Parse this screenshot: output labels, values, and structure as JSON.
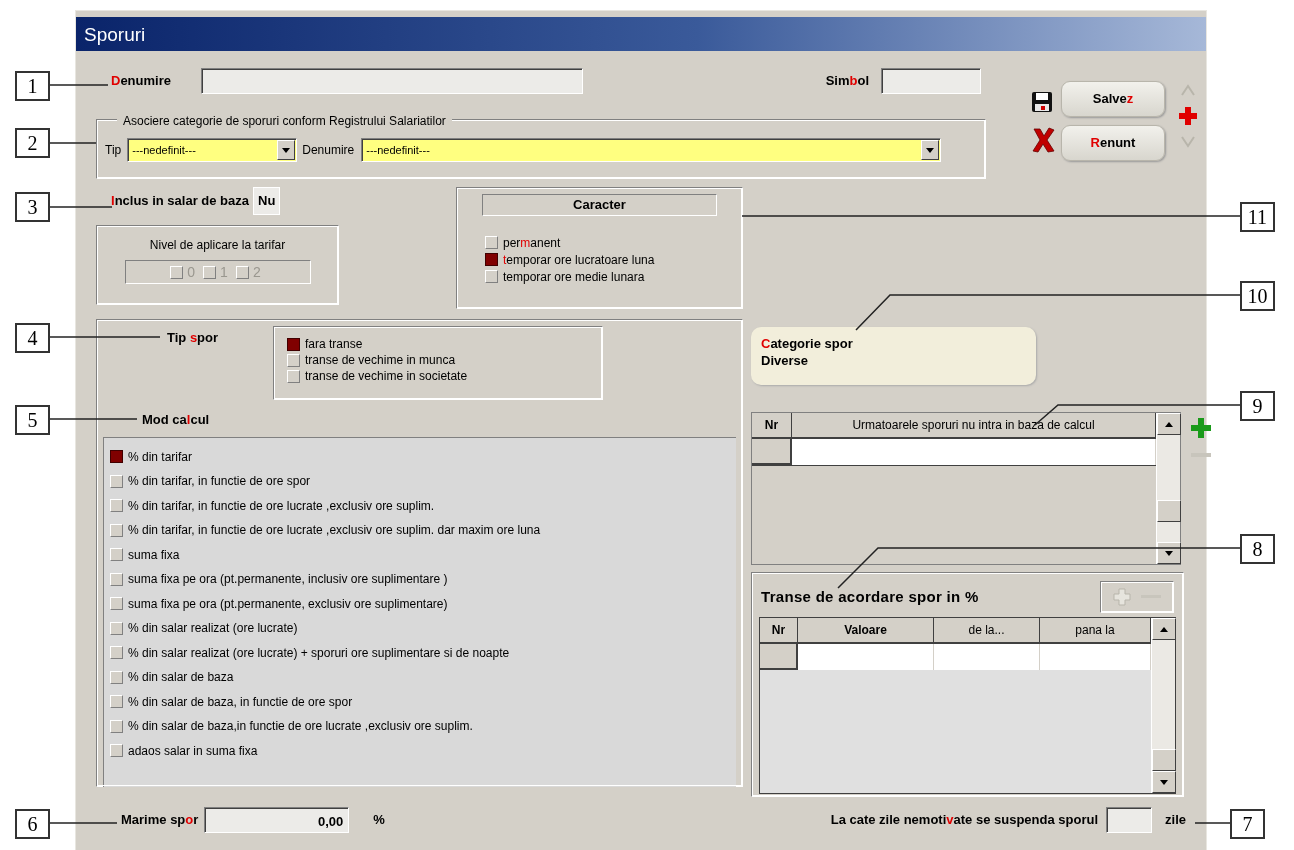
{
  "window": {
    "title": "Sporuri"
  },
  "denumire": {
    "label": [
      {
        "text": "D",
        "accent": true
      },
      {
        "text": "enumire",
        "accent": false
      }
    ]
  },
  "simbol": {
    "label": [
      {
        "text": "Sim",
        "accent": false
      },
      {
        "text": "b",
        "accent": true
      },
      {
        "text": "ol",
        "accent": false
      }
    ]
  },
  "asociere": {
    "legend": "Asociere categorie de sporuri conform Registrului Salariatilor",
    "tip": {
      "label": "Tip",
      "value": "---nedefinit---"
    },
    "denumire": {
      "label": "Denumire",
      "value": "---nedefinit---"
    }
  },
  "actions": [
    {
      "kind": "save",
      "label": [
        {
          "text": "Salve",
          "accent": false
        },
        {
          "text": "z",
          "accent": true
        }
      ]
    },
    {
      "kind": "cancel",
      "label": [
        {
          "text": "R",
          "accent": true
        },
        {
          "text": "enunt",
          "accent": false
        }
      ]
    }
  ],
  "nav": [
    {
      "kind": "up",
      "disabled": true
    },
    {
      "kind": "add",
      "disabled": false
    },
    {
      "kind": "down",
      "disabled": true
    }
  ],
  "inclus": {
    "label": [
      {
        "text": "I",
        "accent": true
      },
      {
        "text": "nclus in salar de baza",
        "accent": false
      }
    ],
    "value": "Nu"
  },
  "nivel": {
    "title": "Nivel de aplicare la tarifar",
    "disabled": true,
    "options": [
      {
        "label": "0",
        "checked": false
      },
      {
        "label": "1",
        "checked": false
      },
      {
        "label": "2",
        "checked": false
      }
    ]
  },
  "caracter": {
    "title": "Caracter",
    "options": [
      {
        "label": [
          {
            "text": "per",
            "accent": false
          },
          {
            "text": "m",
            "accent": true
          },
          {
            "text": "anent",
            "accent": false
          }
        ],
        "selected": false
      },
      {
        "label": [
          {
            "text": "t",
            "accent": true
          },
          {
            "text": "emporar ore lucratoare luna",
            "accent": false
          }
        ],
        "selected": true
      },
      {
        "label": [
          {
            "text": "temporar ore medie lunara",
            "accent": false
          }
        ],
        "selected": false
      }
    ]
  },
  "tip_spor": {
    "label": [
      {
        "text": "Tip ",
        "accent": false
      },
      {
        "text": "s",
        "accent": true
      },
      {
        "text": "por",
        "accent": false
      }
    ],
    "options": [
      {
        "label": "fara transe",
        "selected": true
      },
      {
        "label": "transe de vechime in munca",
        "selected": false
      },
      {
        "label": "transe de vechime in societate",
        "selected": false
      }
    ]
  },
  "mod_calcul": {
    "label": [
      {
        "text": "Mod ca",
        "accent": false
      },
      {
        "text": "l",
        "accent": true
      },
      {
        "text": "cul",
        "accent": false
      }
    ],
    "options": [
      {
        "label": "% din tarifar",
        "selected": true
      },
      {
        "label": "% din tarifar, in functie de ore spor",
        "selected": false
      },
      {
        "label": "% din tarifar, in functie de ore lucrate ,exclusiv ore suplim.",
        "selected": false
      },
      {
        "label": "% din tarifar, in functie de ore lucrate ,exclusiv ore suplim. dar maxim ore luna",
        "selected": false
      },
      {
        "label": "suma fixa",
        "selected": false
      },
      {
        "label": "suma fixa pe ora (pt.permanente, inclusiv ore suplimentare )",
        "selected": false
      },
      {
        "label": "suma fixa pe ora (pt.permanente, exclusiv ore suplimentare)",
        "selected": false
      },
      {
        "label": "% din salar realizat (ore lucrate)",
        "selected": false
      },
      {
        "label": "% din salar realizat (ore lucrate) + sporuri ore suplimentare si de noapte",
        "selected": false
      },
      {
        "label": "% din salar de baza",
        "selected": false
      },
      {
        "label": "% din salar de baza, in functie de ore spor",
        "selected": false
      },
      {
        "label": "% din salar de baza,in functie de ore lucrate ,exclusiv ore suplim.",
        "selected": false
      },
      {
        "label": "adaos salar in suma fixa",
        "selected": false
      }
    ]
  },
  "categorie": {
    "label": [
      {
        "text": "C",
        "accent": true
      },
      {
        "text": "ategorie spor",
        "accent": false
      }
    ],
    "value": "Diverse"
  },
  "excluded_table": {
    "columns": [
      {
        "label": "Nr",
        "bold": true
      },
      {
        "label": "Urmatoarele sporuri nu intra in baza de calcul",
        "bold": false
      }
    ],
    "add_disabled": false,
    "remove_disabled": true
  },
  "transe": {
    "title": "Transe de acordare spor in %",
    "columns": [
      {
        "label": "Nr",
        "bold": true
      },
      {
        "label": "Valoare",
        "bold": true
      },
      {
        "label": "de la...",
        "bold": false
      },
      {
        "label": "pana la",
        "bold": false
      }
    ],
    "add_disabled": true,
    "remove_disabled": true
  },
  "marime": {
    "label": [
      {
        "text": "Marime sp",
        "accent": false
      },
      {
        "text": "o",
        "accent": true
      },
      {
        "text": "r",
        "accent": false
      }
    ],
    "value": "0,00",
    "unit": "%"
  },
  "suspend": {
    "label": [
      {
        "text": "La cate zile nemoti",
        "accent": false
      },
      {
        "text": "v",
        "accent": true
      },
      {
        "text": "ate se suspenda sporul",
        "accent": false
      }
    ],
    "unit": "zile"
  },
  "callouts": [
    {
      "number": "1"
    },
    {
      "number": "2"
    },
    {
      "number": "3"
    },
    {
      "number": "11"
    },
    {
      "number": "10"
    },
    {
      "number": "4"
    },
    {
      "number": "9"
    },
    {
      "number": "5"
    },
    {
      "number": "8"
    },
    {
      "number": "6"
    },
    {
      "number": "7"
    }
  ]
}
